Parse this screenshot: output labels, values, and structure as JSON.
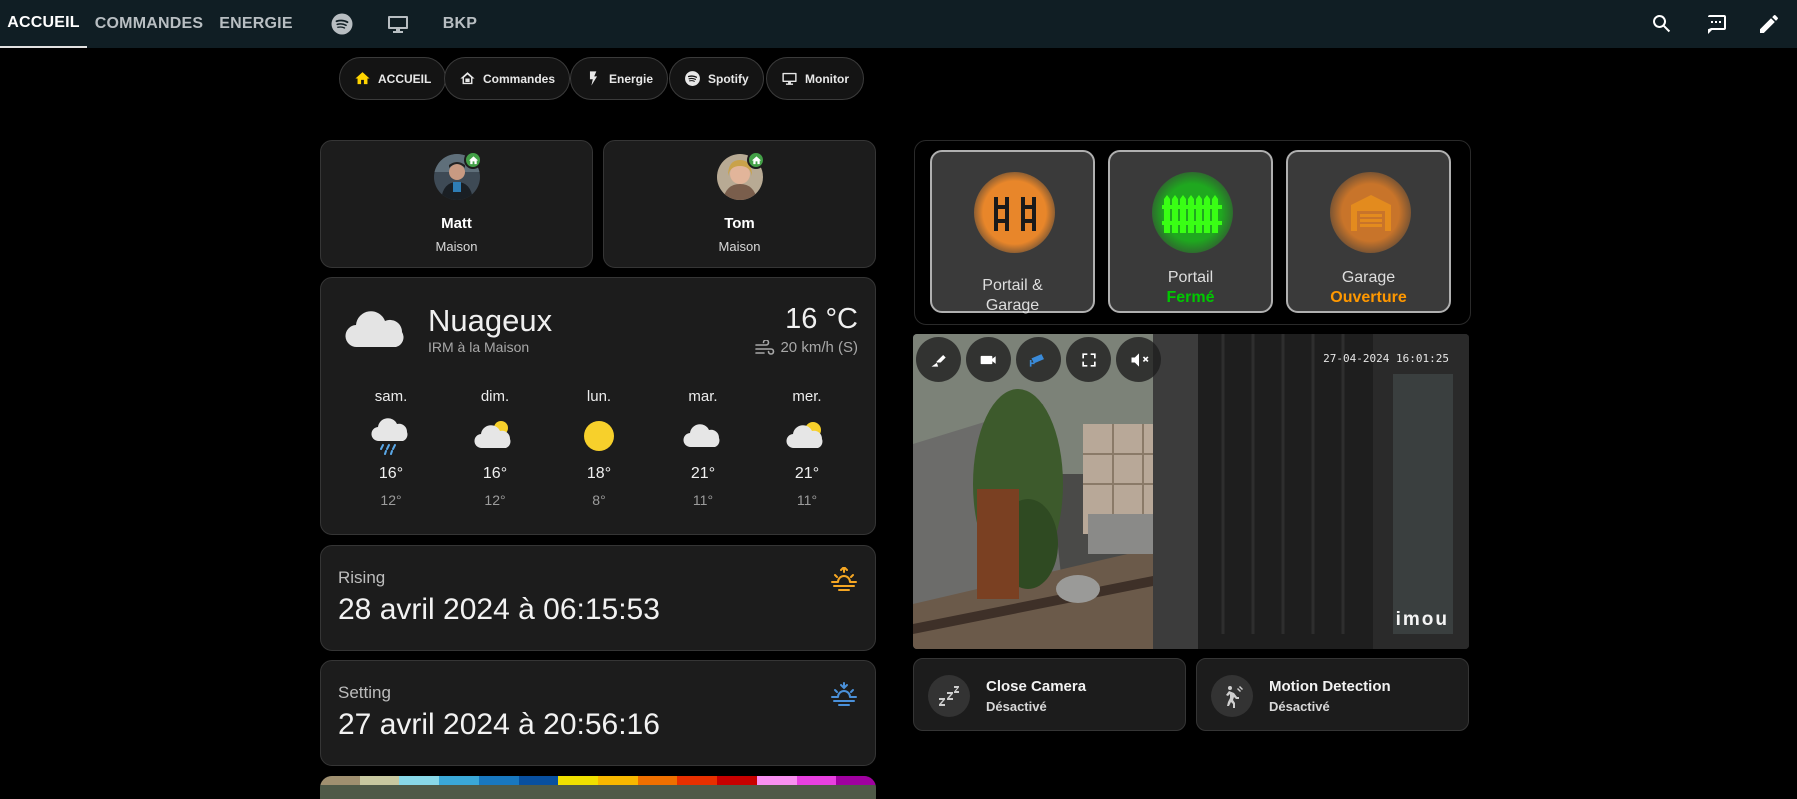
{
  "topbar": {
    "tabs": [
      {
        "label": "ACCUEIL",
        "active": true
      },
      {
        "label": "COMMANDES"
      },
      {
        "label": "ENERGIE"
      },
      {
        "icon": "spotify-icon"
      },
      {
        "icon": "monitor-icon"
      },
      {
        "label": "BKP"
      }
    ],
    "actions": [
      "search-icon",
      "assist-chat-icon",
      "edit-pencil-icon"
    ]
  },
  "nav_chips": [
    {
      "label": "ACCUEIL",
      "icon": "home-icon",
      "icon_color": "#ffd400"
    },
    {
      "label": "Commandes",
      "icon": "home-outline-icon"
    },
    {
      "label": "Energie",
      "icon": "flash-icon"
    },
    {
      "label": "Spotify",
      "icon": "spotify-icon"
    },
    {
      "label": "Monitor",
      "icon": "monitor-icon"
    }
  ],
  "persons": [
    {
      "name": "Matt",
      "state": "Maison"
    },
    {
      "name": "Tom",
      "state": "Maison"
    }
  ],
  "weather": {
    "condition": "Nuageux",
    "source": "IRM à la Maison",
    "temperature": "16 °C",
    "wind": "20 km/h (S)",
    "forecast": [
      {
        "day": "sam.",
        "icon": "rainy-cloud-icon",
        "high": "16°",
        "low": "12°"
      },
      {
        "day": "dim.",
        "icon": "partly-cloudy-icon",
        "high": "16°",
        "low": "12°"
      },
      {
        "day": "lun.",
        "icon": "sun-icon",
        "high": "18°",
        "low": "8°"
      },
      {
        "day": "mar.",
        "icon": "cloud-icon",
        "high": "21°",
        "low": "11°"
      },
      {
        "day": "mer.",
        "icon": "partly-cloudy-icon",
        "high": "21°",
        "low": "11°"
      }
    ]
  },
  "sun": {
    "rising": {
      "label": "Rising",
      "value": "28 avril 2024 à 06:15:53",
      "color": "#f5a623"
    },
    "setting": {
      "label": "Setting",
      "value": "27 avril 2024 à 20:56:16",
      "color": "#4a90d9"
    }
  },
  "covers": [
    {
      "label": "Portail & Garage",
      "state": "",
      "icon": "gate-open-icon",
      "color": "#ff9800"
    },
    {
      "label": "Portail",
      "state": "Fermé",
      "icon": "gate-closed-icon",
      "color": "#00e600"
    },
    {
      "label": "Garage",
      "state": "Ouverture",
      "icon": "garage-icon",
      "color": "#ff9800"
    }
  ],
  "camera": {
    "timestamp": "27-04-2024 16:01:25",
    "brand": "imou",
    "controls": [
      "ptz-icon",
      "record-icon",
      "cctv-icon",
      "fullscreen-icon",
      "mute-icon"
    ]
  },
  "tiles": [
    {
      "name": "Close Camera",
      "state": "Désactivé",
      "icon": "sleep-icon"
    },
    {
      "name": "Motion Detection",
      "state": "Désactivé",
      "icon": "motion-sensor-icon"
    }
  ]
}
